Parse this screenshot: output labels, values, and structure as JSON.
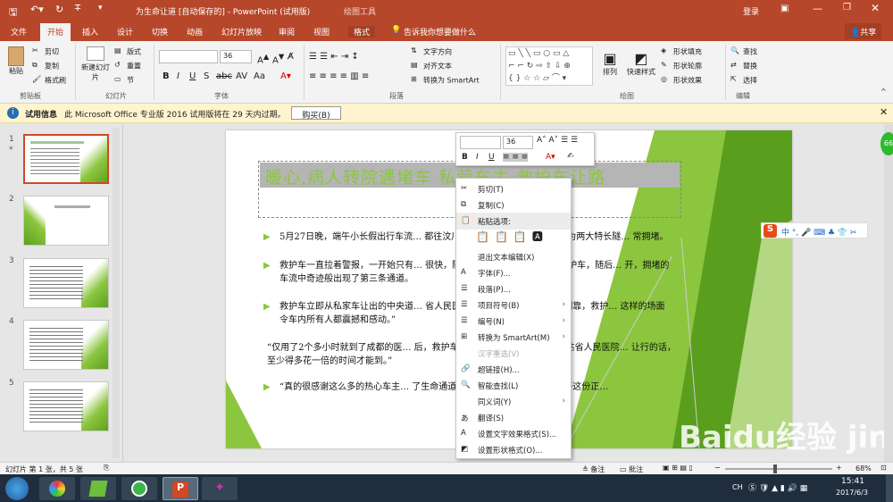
{
  "window": {
    "title": "为生命让道 [自动保存的] - PowerPoint (试用版)",
    "context_tool": "绘图工具",
    "login": "登录"
  },
  "tabs": [
    "文件",
    "开始",
    "插入",
    "设计",
    "切换",
    "动画",
    "幻灯片放映",
    "审阅",
    "视图",
    "格式"
  ],
  "tell_me": "告诉我你想要做什么",
  "share": "共享",
  "ribbon": {
    "clipboard": {
      "paste": "粘贴",
      "cut": "剪切",
      "copy": "复制",
      "format_painter": "格式刷",
      "group": "剪贴板"
    },
    "slides": {
      "new_slide": "新建幻灯片",
      "layout": "版式",
      "reset": "重置",
      "section": "节",
      "group": "幻灯片"
    },
    "font": {
      "size": "36",
      "group": "字体"
    },
    "paragraph": {
      "text_direction": "文字方向",
      "align_text": "对齐文本",
      "smartart": "转换为 SmartArt",
      "group": "段落"
    },
    "drawing": {
      "arrange": "排列",
      "quick_styles": "快速样式",
      "fill": "形状填充",
      "outline": "形状轮廓",
      "effects": "形状效果",
      "group": "绘图"
    },
    "editing": {
      "find": "查找",
      "replace": "替换",
      "select": "选择",
      "group": "编辑"
    }
  },
  "infobar": {
    "label": "试用信息",
    "message": "此 Microsoft Office 专业版 2016 试用版将在 29 天内过期。",
    "button": "购买(B)"
  },
  "thumbnails": [
    {
      "num": "1",
      "star": "*"
    },
    {
      "num": "2"
    },
    {
      "num": "3"
    },
    {
      "num": "4"
    },
    {
      "num": "5"
    }
  ],
  "slide": {
    "title": "暖心,病人转院遇堵车 私营车主 救护车让路",
    "paragraphs": [
      "5月27日晚，端午小长假出行车流… 都往汶川方向、汶川往成都方向。因为两大特长隧… 常拥堵。",
      "救护车一直拉着警报，一开始只有… 很快，隧道里的其他司机也发现了救护车，随后… 开，拥堵的车流中奇迹般出现了第三条通道。",
      "救护车立即从私家车让出的中央道… 省人民医院。“前面车子齐刷刷往两侧靠，救护… 这样的场面令车内所有人都震撼和感动。”",
      "“仅用了2个多小时就到了成都的医… 后，救护车从映秀隧道通过后，安全抵达省人民医院… 让行的话，至少得多花一倍的时间才能到。”",
      "“真的很感谢这么多的热心车主… 了生命通道，不仅救助了危重病人，也将这份正…"
    ]
  },
  "mini_toolbar": {
    "size": "36"
  },
  "context_menu": [
    {
      "label": "剪切(T)",
      "icon": "scissors-icon"
    },
    {
      "label": "复制(C)",
      "icon": "copy-icon"
    },
    {
      "label": "粘贴选项:",
      "icon": "paste-icon",
      "header": true
    },
    {
      "label": "退出文本编辑(X)",
      "icon": ""
    },
    {
      "label": "字体(F)...",
      "icon": "font-icon"
    },
    {
      "label": "段落(P)...",
      "icon": "paragraph-icon"
    },
    {
      "label": "项目符号(B)",
      "icon": "bullets-icon",
      "sub": true
    },
    {
      "label": "编号(N)",
      "icon": "numbering-icon",
      "sub": true
    },
    {
      "label": "转换为 SmartArt(M)",
      "icon": "smartart-icon",
      "sub": true
    },
    {
      "label": "汉字重选(V)",
      "icon": "",
      "disabled": true
    },
    {
      "label": "超链接(H)...",
      "icon": "hyperlink-icon"
    },
    {
      "label": "智能查找(L)",
      "icon": "search-icon"
    },
    {
      "label": "同义词(Y)",
      "icon": "",
      "sub": true
    },
    {
      "label": "翻译(S)",
      "icon": "translate-icon"
    },
    {
      "label": "设置文字效果格式(S)...",
      "icon": "text-effect-icon"
    },
    {
      "label": "设置形状格式(O)...",
      "icon": "shape-format-icon"
    }
  ],
  "statusbar": {
    "slide_info": "幻灯片 第 1 张，共 5 张",
    "notes": "备注",
    "comments": "批注",
    "zoom": "68%"
  },
  "taskbar": {
    "time": "15:41",
    "date": "2017/6/3",
    "lang": "CH"
  },
  "watermark": "Baidu经验 jingyan.baidu.com",
  "badge": "66"
}
